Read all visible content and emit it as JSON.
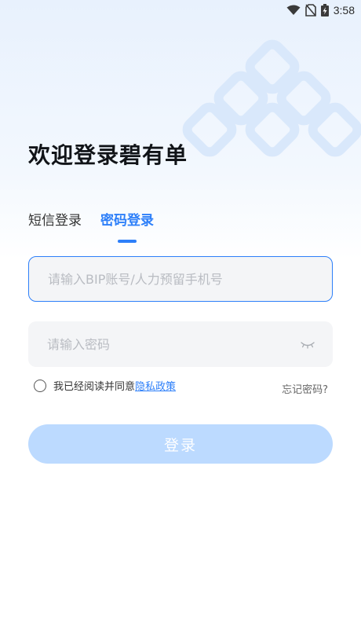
{
  "status_bar": {
    "time": "3:58",
    "icons": [
      "wifi-icon",
      "no-sim-icon",
      "battery-charging-icon"
    ]
  },
  "header": {
    "title": "欢迎登录碧有单"
  },
  "tabs": [
    {
      "label": "短信登录",
      "active": false
    },
    {
      "label": "密码登录",
      "active": true
    }
  ],
  "form": {
    "account_placeholder": "请输入BIP账号/人力预留手机号",
    "account_value": "",
    "password_placeholder": "请输入密码",
    "password_value": "",
    "password_toggle_icon": "eye-closed-icon"
  },
  "agreement": {
    "checked": false,
    "prefix": "我已经阅读并同意",
    "link_label": "隐私政策"
  },
  "forgot_password_label": "忘记密码?",
  "login_button_label": "登录",
  "colors": {
    "accent": "#2d7ff9",
    "button_disabled": "#bcdaff",
    "field_bg": "#f4f5f7",
    "title_text": "#111418"
  }
}
